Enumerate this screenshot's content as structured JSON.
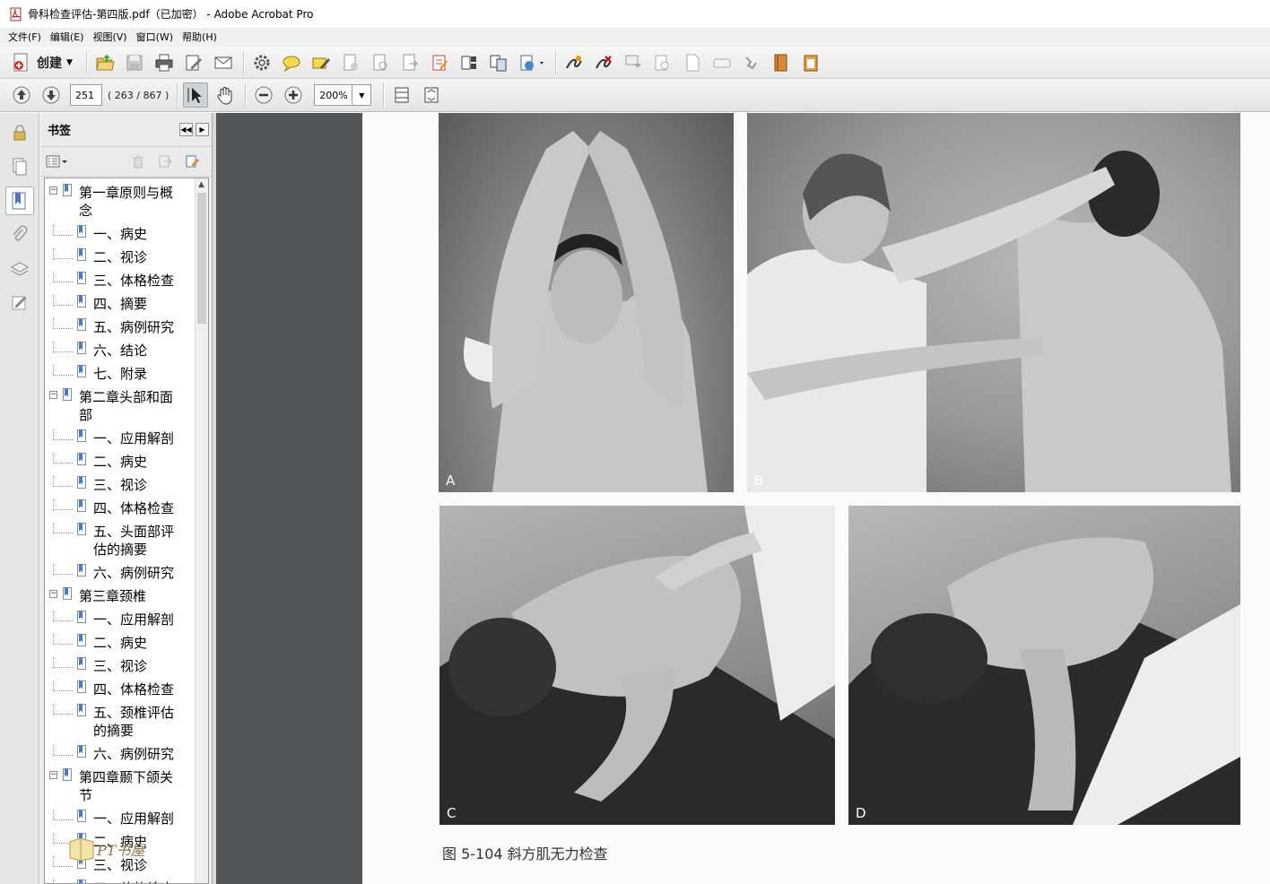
{
  "window": {
    "title": "骨科检查评估-第四版.pdf（已加密） - Adobe Acrobat Pro"
  },
  "menu": [
    "文件(F)",
    "编辑(E)",
    "视图(V)",
    "窗口(W)",
    "帮助(H)"
  ],
  "toolbar": {
    "create_label": "创建"
  },
  "nav": {
    "page_value": "251",
    "page_count": "( 263 / 867 )",
    "zoom": "200%"
  },
  "bookmarks": {
    "title": "书签",
    "items": [
      {
        "label": "第一章原则与概",
        "cont": "念",
        "level": 0
      },
      {
        "label": "一、病史",
        "level": 1
      },
      {
        "label": "二、视诊",
        "level": 1
      },
      {
        "label": "三、体格检查",
        "level": 1
      },
      {
        "label": "四、摘要",
        "level": 1
      },
      {
        "label": "五、病例研究",
        "level": 1
      },
      {
        "label": "六、结论",
        "level": 1
      },
      {
        "label": "七、附录",
        "level": 1
      },
      {
        "label": "第二章头部和面",
        "cont": "部",
        "level": 0
      },
      {
        "label": "一、应用解剖",
        "level": 1
      },
      {
        "label": "二、病史",
        "level": 1
      },
      {
        "label": "三、视诊",
        "level": 1
      },
      {
        "label": "四、体格检查",
        "level": 1
      },
      {
        "label": "五、头面部评",
        "cont": "估的摘要",
        "level": 1
      },
      {
        "label": "六、病例研究",
        "level": 1
      },
      {
        "label": "第三章颈椎",
        "level": 0
      },
      {
        "label": "一、应用解剖",
        "level": 1
      },
      {
        "label": "二、病史",
        "level": 1
      },
      {
        "label": "三、视诊",
        "level": 1
      },
      {
        "label": "四、体格检查",
        "level": 1
      },
      {
        "label": "五、颈椎评估",
        "cont": "的摘要",
        "level": 1
      },
      {
        "label": "六、病例研究",
        "level": 1
      },
      {
        "label": "第四章颞下颌关",
        "cont": "节",
        "level": 0
      },
      {
        "label": "一、应用解剖",
        "level": 1
      },
      {
        "label": "二、病史",
        "level": 1
      },
      {
        "label": "三、视诊",
        "level": 1
      },
      {
        "label": "四、体格检查",
        "level": 1
      }
    ]
  },
  "document": {
    "photos": [
      "A",
      "B",
      "C",
      "D"
    ],
    "caption": "图 5-104   斜方肌无力检查"
  },
  "watermark": {
    "text": "PT书屋"
  }
}
